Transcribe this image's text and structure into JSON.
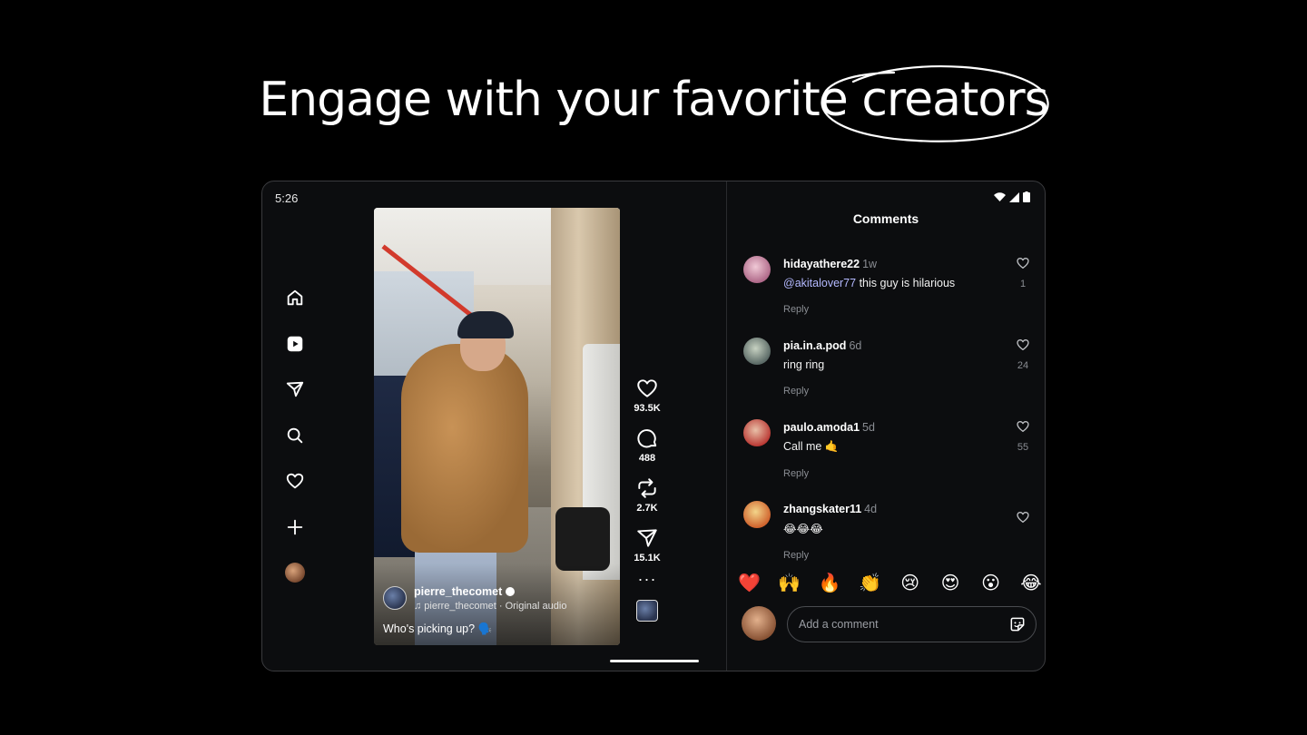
{
  "headline": {
    "text": "Engage with your favorite creators"
  },
  "status": {
    "time": "5:26"
  },
  "nav": [
    {
      "name": "home-icon"
    },
    {
      "name": "reels-icon"
    },
    {
      "name": "send-icon"
    },
    {
      "name": "search-icon"
    },
    {
      "name": "heart-icon"
    },
    {
      "name": "plus-icon"
    },
    {
      "name": "profile-avatar"
    }
  ],
  "video": {
    "author": "pierre_thecomet",
    "audio": "♫ pierre_thecomet · Original audio",
    "caption": "Who's picking up? 🗣️"
  },
  "actions": {
    "likes": "93.5K",
    "comments": "488",
    "reposts": "2.7K",
    "shares": "15.1K"
  },
  "comments_panel": {
    "title": "Comments",
    "items": [
      {
        "user": "hidayathere22",
        "time": "1w",
        "mention": "@akitalover77",
        "text": " this guy is hilarious",
        "reply": "Reply",
        "likes": "1"
      },
      {
        "user": "pia.in.a.pod",
        "time": "6d",
        "mention": "",
        "text": "ring ring",
        "reply": "Reply",
        "likes": "24"
      },
      {
        "user": "paulo.amoda1",
        "time": "5d",
        "mention": "",
        "text": "Call me 🤙",
        "reply": "Reply",
        "likes": "55"
      },
      {
        "user": "zhangskater11",
        "time": "4d",
        "mention": "",
        "text": "😂😂😂",
        "reply": "Reply",
        "likes": ""
      }
    ],
    "emojis": [
      "❤️",
      "🙌",
      "🔥",
      "👏",
      "😢",
      "😍",
      "😮",
      "😂"
    ],
    "input_placeholder": "Add a comment"
  }
}
